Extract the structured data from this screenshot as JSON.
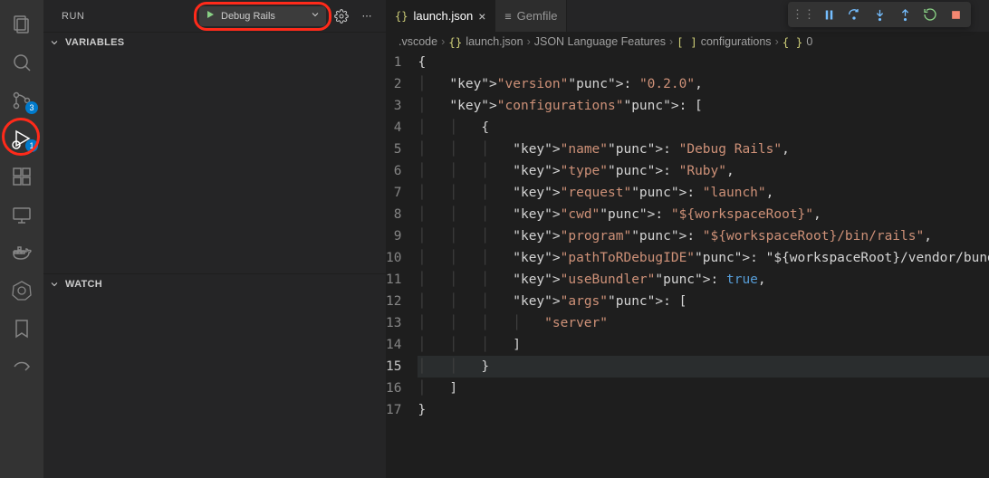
{
  "activity": {
    "scm_badge": "3",
    "debug_badge": "1"
  },
  "sidebar": {
    "title": "RUN",
    "config_label": "Debug Rails",
    "sections": {
      "variables": "VARIABLES",
      "watch": "WATCH"
    }
  },
  "tabs": [
    {
      "icon": "{}",
      "label": "launch.json",
      "active": true
    },
    {
      "icon": "≡",
      "label": "Gemfile",
      "active": false
    }
  ],
  "breadcrumbs": {
    "p0": ".vscode",
    "p1": "launch.json",
    "p2": "JSON Language Features",
    "p3": "configurations",
    "p4": "0"
  },
  "editor": {
    "current_line": 15,
    "lines": [
      "{",
      "    \"version\": \"0.2.0\",",
      "    \"configurations\": [",
      "        {",
      "            \"name\": \"Debug Rails\",",
      "            \"type\": \"Ruby\",",
      "            \"request\": \"launch\",",
      "            \"cwd\": \"${workspaceRoot}\",",
      "            \"program\": \"${workspaceRoot}/bin/rails\",",
      "            \"pathToRDebugIDE\": \"${workspaceRoot}/vendor/bundle/ruby",
      "            \"useBundler\": true,",
      "            \"args\": [",
      "                \"server\"",
      "            ]",
      "        }",
      "    ]",
      "}"
    ]
  },
  "launch_json": {
    "version": "0.2.0",
    "configurations": [
      {
        "name": "Debug Rails",
        "type": "Ruby",
        "request": "launch",
        "cwd": "${workspaceRoot}",
        "program": "${workspaceRoot}/bin/rails",
        "pathToRDebugIDE": "${workspaceRoot}/vendor/bundle/ruby",
        "useBundler": true,
        "args": [
          "server"
        ]
      }
    ]
  }
}
